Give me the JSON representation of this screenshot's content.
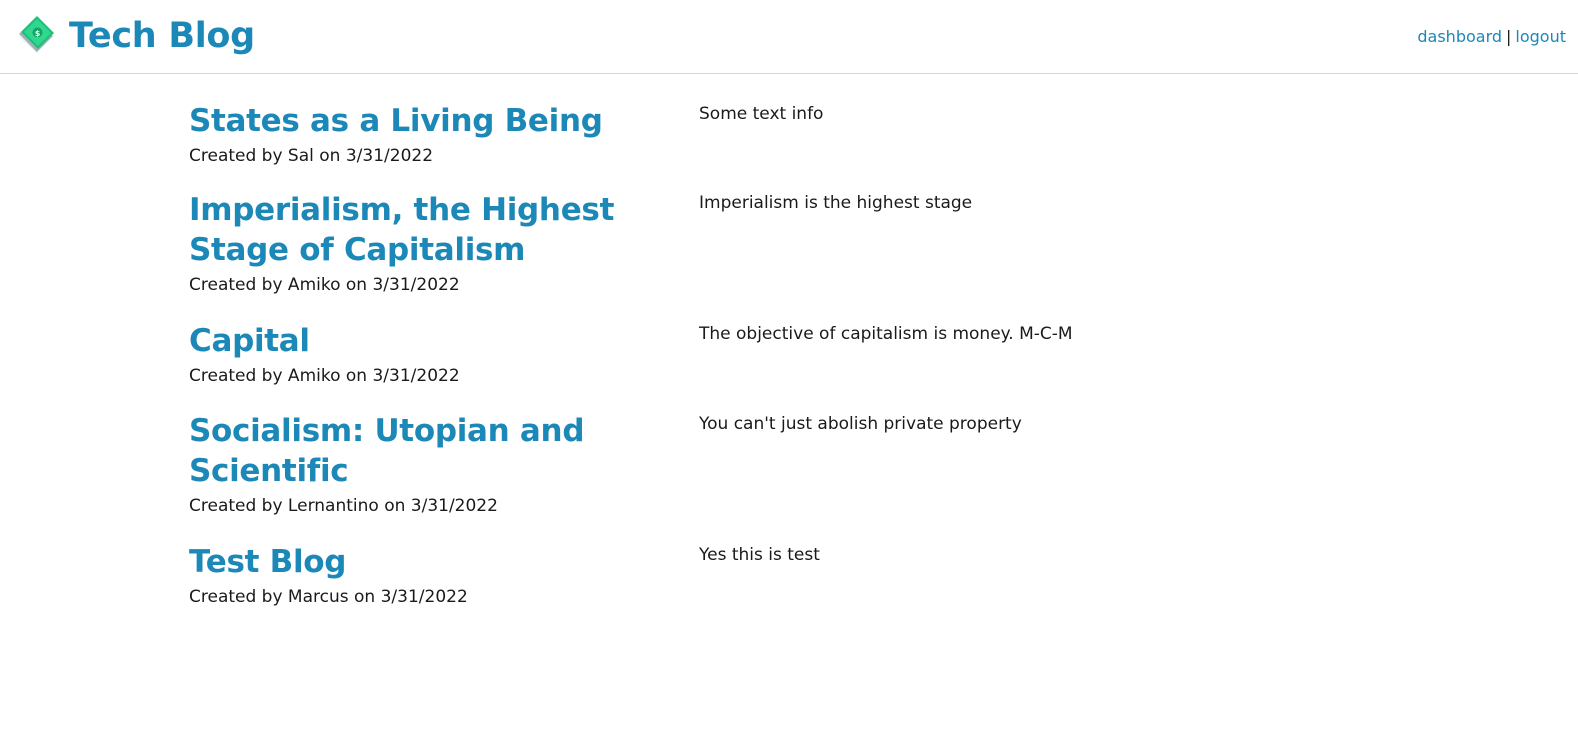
{
  "header": {
    "title": "Tech Blog",
    "logo_icon": "money-stack-icon",
    "nav": {
      "dashboard": "dashboard",
      "separator": "|",
      "logout": "logout"
    }
  },
  "colors": {
    "accent": "#1c88b8",
    "text": "#1a1a1a",
    "border": "#d6d6d6"
  },
  "posts": [
    {
      "title": "States as a Living Being",
      "meta": "Created by Sal on 3/31/2022",
      "body": "Some text info"
    },
    {
      "title": "Imperialism, the Highest Stage of Capitalism",
      "meta": "Created by Amiko on 3/31/2022",
      "body": "Imperialism is the highest stage"
    },
    {
      "title": "Capital",
      "meta": "Created by Amiko on 3/31/2022",
      "body": "The objective of capitalism is money. M-C-M"
    },
    {
      "title": "Socialism: Utopian and Scientific",
      "meta": "Created by Lernantino on 3/31/2022",
      "body": "You can't just abolish private property"
    },
    {
      "title": "Test Blog",
      "meta": "Created by Marcus on 3/31/2022",
      "body": "Yes this is test"
    }
  ]
}
